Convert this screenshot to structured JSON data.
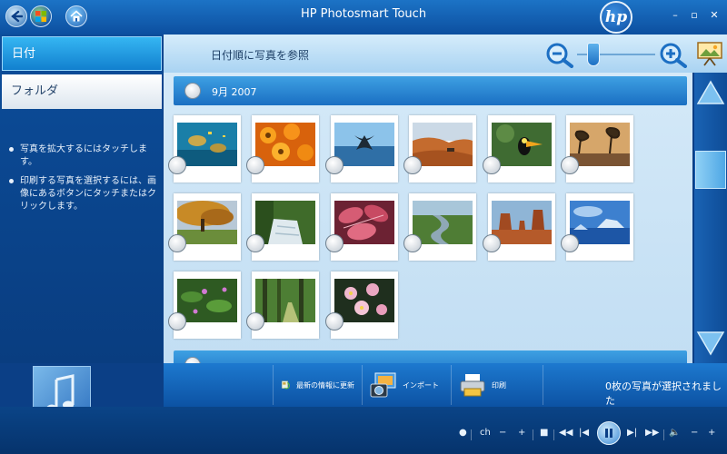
{
  "app": {
    "title": "HP Photosmart Touch",
    "logo": "hp"
  },
  "window": {
    "min": "–",
    "max": "▫",
    "close": "✕"
  },
  "sidebar": {
    "tabs": [
      {
        "label": "日付",
        "active": true
      },
      {
        "label": "フォルダ",
        "active": false
      }
    ],
    "tips": [
      "写真を拡大するにはタッチします。",
      "印刷する写真を選択するには、画像にあるボタンにタッチまたはクリックします。"
    ]
  },
  "header": {
    "sort_label": "日付順に写真を参照",
    "zoom_level_fraction": 0.15
  },
  "gallery": {
    "group_label": "9月 2007",
    "photos": [
      {
        "subject": "sea-turtles"
      },
      {
        "subject": "orange-flowers"
      },
      {
        "subject": "whale-tail"
      },
      {
        "subject": "desert-dunes"
      },
      {
        "subject": "toucan"
      },
      {
        "subject": "savanna-trees"
      },
      {
        "subject": "autumn-tree"
      },
      {
        "subject": "waterfall"
      },
      {
        "subject": "pink-leaves"
      },
      {
        "subject": "river-valley"
      },
      {
        "subject": "monument-valley"
      },
      {
        "subject": "icebergs"
      },
      {
        "subject": "green-plants"
      },
      {
        "subject": "forest-path"
      },
      {
        "subject": "pink-blossoms"
      }
    ]
  },
  "actions": {
    "refresh_label": "最新の情報に更新",
    "import_label": "インポート",
    "print_label": "印刷",
    "selected_count": "0枚の写真が選択されました"
  },
  "media": {
    "ch_label": "ch",
    "minus": "−",
    "plus": "+",
    "stop": "■",
    "rewind": "◀◀",
    "prev": "|◀",
    "next": "▶|",
    "forward": "▶▶",
    "volume_icon": "🔈",
    "vol_minus": "−",
    "vol_plus": "+"
  },
  "colors": {
    "accent": "#1a6fc2",
    "panel": "#0b3f86",
    "gallery_bg": "#d4e9f8"
  }
}
